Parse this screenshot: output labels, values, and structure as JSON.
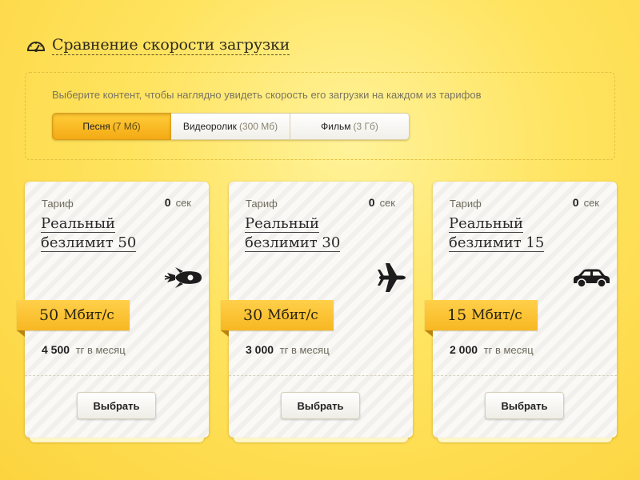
{
  "header": {
    "title": "Сравнение скорости загрузки",
    "icon": "speedometer-icon"
  },
  "selector": {
    "hint": "Выберите контент, чтобы наглядно увидеть скорость его загрузки на каждом из тарифов",
    "tabs": [
      {
        "label": "Песня",
        "size": "(7 Мб)",
        "active": true
      },
      {
        "label": "Видеоролик",
        "size": "(300 Мб)",
        "active": false
      },
      {
        "label": "Фильм",
        "size": "(3 Гб)",
        "active": false
      }
    ]
  },
  "cards": [
    {
      "tariff_label": "Тариф",
      "time_value": "0",
      "time_unit": "сек",
      "name": "Реальный безлимит 50",
      "speed_value": "50",
      "speed_unit": "Мбит/с",
      "price_value": "4 500",
      "price_unit": "тг в месяц",
      "button": "Выбрать",
      "icon": "rocket-icon"
    },
    {
      "tariff_label": "Тариф",
      "time_value": "0",
      "time_unit": "сек",
      "name": "Реальный безлимит 30",
      "speed_value": "30",
      "speed_unit": "Мбит/с",
      "price_value": "3 000",
      "price_unit": "тг в месяц",
      "button": "Выбрать",
      "icon": "airplane-icon"
    },
    {
      "tariff_label": "Тариф",
      "time_value": "0",
      "time_unit": "сек",
      "name": "Реальный безлимит 15",
      "speed_value": "15",
      "speed_unit": "Мбит/с",
      "price_value": "2 000",
      "price_unit": "тг в месяц",
      "button": "Выбрать",
      "icon": "car-icon"
    }
  ],
  "colors": {
    "accent": "#f7b722",
    "background": "#ffe35e"
  }
}
